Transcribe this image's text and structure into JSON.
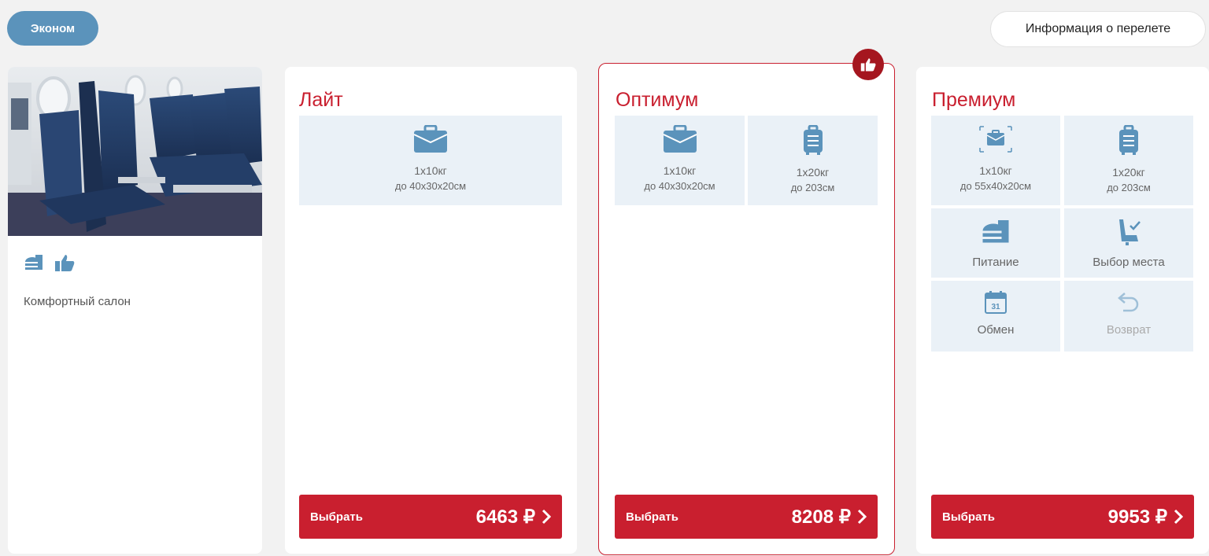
{
  "header": {
    "class_label": "Эконом",
    "info_label": "Информация о перелете"
  },
  "cabin": {
    "photo_icon": "airplane-cabin-photo",
    "icons": [
      "meal-icon",
      "thumbs-up-icon"
    ],
    "description": "Комфортный салон"
  },
  "tariffs": [
    {
      "title": "Лайт",
      "features": [
        {
          "icon": "briefcase-icon",
          "line1": "1x10кг",
          "line2": "до 40x30x20см"
        }
      ],
      "select_label": "Выбрать",
      "price": "6463 ₽"
    },
    {
      "title": "Оптимум",
      "recommended_icon": "thumbs-up-icon",
      "features": [
        {
          "icon": "briefcase-icon",
          "line1": "1x10кг",
          "line2": "до 40x30x20см"
        },
        {
          "icon": "suitcase-icon",
          "line1": "1x20кг",
          "line2": "до 203см"
        }
      ],
      "select_label": "Выбрать",
      "price": "8208 ₽"
    },
    {
      "title": "Премиум",
      "features": [
        {
          "icon": "briefcase-expand-icon",
          "line1": "1x10кг",
          "line2": "до 55x40x20см"
        },
        {
          "icon": "suitcase-icon",
          "line1": "1x20кг",
          "line2": "до 203см"
        },
        {
          "icon": "meal-icon",
          "label": "Питание"
        },
        {
          "icon": "seat-select-icon",
          "label": "Выбор места"
        },
        {
          "icon": "calendar-icon",
          "calendar_day": "31",
          "label": "Обмен"
        },
        {
          "icon": "return-arrow-icon",
          "label": "Возврат",
          "disabled": true
        }
      ],
      "select_label": "Выбрать",
      "price": "9953 ₽"
    }
  ],
  "colors": {
    "brand_red": "#c91f2f",
    "badge_red": "#a5161f",
    "icon_blue": "#5b93bb",
    "feature_bg": "#eaf1f7"
  }
}
